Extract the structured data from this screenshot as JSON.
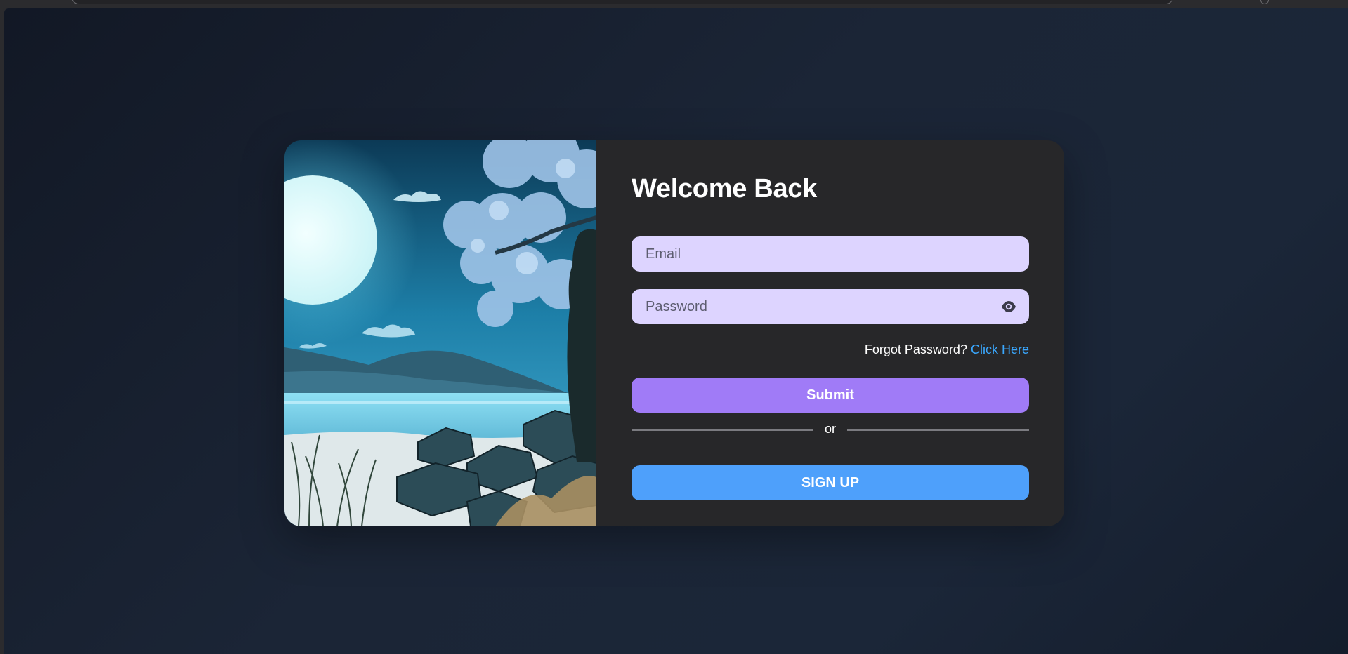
{
  "login": {
    "title": "Welcome Back",
    "email_placeholder": "Email",
    "password_placeholder": "Password",
    "forgot_text": "Forgot Password?",
    "forgot_link": "Click Here",
    "submit_label": "Submit",
    "divider_text": "or",
    "signup_label": "SIGN UP"
  },
  "icons": {
    "password_toggle": "eye-icon"
  },
  "colors": {
    "background": "#1b2536",
    "card": "#272729",
    "input": "#ddd4ff",
    "submit": "#a07bf7",
    "signup": "#4ea0fb",
    "link": "#3aa8ff"
  }
}
